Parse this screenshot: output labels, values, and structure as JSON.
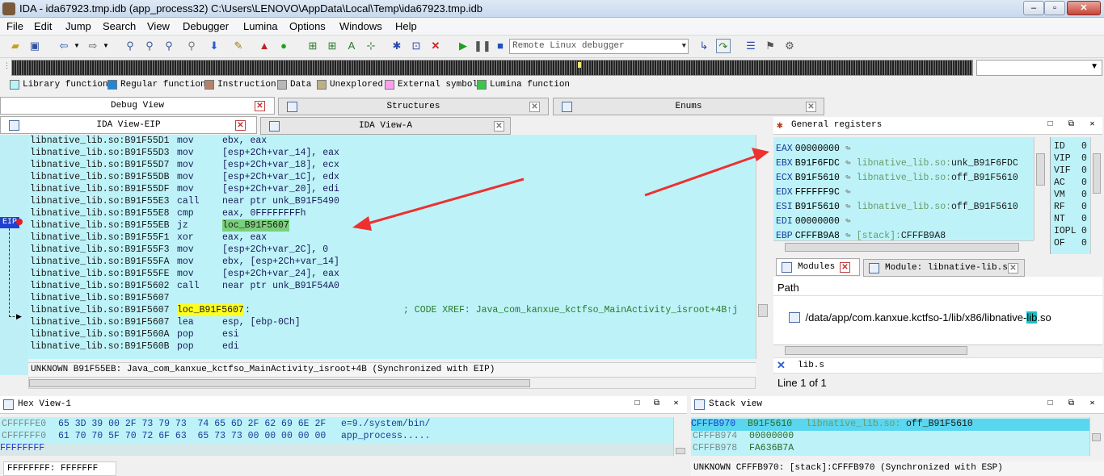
{
  "window": {
    "title": "IDA - ida67923.tmp.idb (app_process32) C:\\Users\\LENOVO\\AppData\\Local\\Temp\\ida67923.tmp.idb"
  },
  "menu": [
    "File",
    "Edit",
    "Jump",
    "Search",
    "View",
    "Debugger",
    "Lumina",
    "Options",
    "Windows",
    "Help"
  ],
  "toolbar": {
    "debugger_select": "Remote Linux debugger"
  },
  "legend": [
    {
      "label": "Library function",
      "color": "#b7f3f9"
    },
    {
      "label": "Regular function",
      "color": "#1e88d8"
    },
    {
      "label": "Instruction",
      "color": "#b5816a"
    },
    {
      "label": "Data",
      "color": "#b8b8b8"
    },
    {
      "label": "Unexplored",
      "color": "#b9b187"
    },
    {
      "label": "External symbol",
      "color": "#ff9ef0"
    },
    {
      "label": "Lumina function",
      "color": "#39c64a"
    }
  ],
  "top_tabs": [
    "Debug View",
    "Structures",
    "Enums"
  ],
  "view_tabs": [
    "IDA View-EIP",
    "IDA View-A"
  ],
  "eip_label": "EIP",
  "code_lines": [
    {
      "addr": "libnative_lib.so:B91F55D1",
      "mn": "mov",
      "op": "ebx, eax"
    },
    {
      "addr": "libnative_lib.so:B91F55D3",
      "mn": "mov",
      "op": "[esp+2Ch+var_14], eax"
    },
    {
      "addr": "libnative_lib.so:B91F55D7",
      "mn": "mov",
      "op": "[esp+2Ch+var_18], ecx"
    },
    {
      "addr": "libnative_lib.so:B91F55DB",
      "mn": "mov",
      "op": "[esp+2Ch+var_1C], edx"
    },
    {
      "addr": "libnative_lib.so:B91F55DF",
      "mn": "mov",
      "op": "[esp+2Ch+var_20], edi"
    },
    {
      "addr": "libnative_lib.so:B91F55E3",
      "mn": "call",
      "op": "near ptr unk_B91F5490"
    },
    {
      "addr": "libnative_lib.so:B91F55E8",
      "mn": "cmp",
      "op": "eax, 0FFFFFFFFh"
    },
    {
      "addr": "libnative_lib.so:B91F55EB",
      "mn": "jz",
      "op": "loc_B91F5607"
    },
    {
      "addr": "libnative_lib.so:B91F55F1",
      "mn": "xor",
      "op": "eax, eax"
    },
    {
      "addr": "libnative_lib.so:B91F55F3",
      "mn": "mov",
      "op": "[esp+2Ch+var_2C], 0"
    },
    {
      "addr": "libnative_lib.so:B91F55FA",
      "mn": "mov",
      "op": "ebx, [esp+2Ch+var_14]"
    },
    {
      "addr": "libnative_lib.so:B91F55FE",
      "mn": "mov",
      "op": "[esp+2Ch+var_24], eax"
    },
    {
      "addr": "libnative_lib.so:B91F5602",
      "mn": "call",
      "op": "near ptr unk_B91F54A0"
    },
    {
      "addr": "libnative_lib.so:B91F5607",
      "mn": "",
      "op": ""
    },
    {
      "addr": "libnative_lib.so:B91F5607",
      "label": "loc_B91F5607",
      "comment": "; CODE XREF: Java_com_kanxue_kctfso_MainActivity_isroot+4B↑j"
    },
    {
      "addr": "libnative_lib.so:B91F5607",
      "mn": "lea",
      "op": "esp, [ebp-0Ch]"
    },
    {
      "addr": "libnative_lib.so:B91F560A",
      "mn": "pop",
      "op": "esi"
    },
    {
      "addr": "libnative_lib.so:B91F560B",
      "mn": "pop",
      "op": "edi"
    }
  ],
  "ida_status": "UNKNOWN B91F55EB: Java_com_kanxue_kctfso_MainActivity_isroot+4B (Synchronized with EIP)",
  "registers_title": "General registers",
  "registers": [
    {
      "name": "EAX",
      "value": "00000000",
      "ref": "",
      "sym": ""
    },
    {
      "name": "EBX",
      "value": "B91F6FDC",
      "ref": "libnative_lib.so:",
      "sym": "unk_B91F6FDC"
    },
    {
      "name": "ECX",
      "value": "B91F5610",
      "ref": "libnative_lib.so:",
      "sym": "off_B91F5610"
    },
    {
      "name": "EDX",
      "value": "FFFFFF9C",
      "ref": "",
      "sym": ""
    },
    {
      "name": "ESI",
      "value": "B91F5610",
      "ref": "libnative_lib.so:",
      "sym": "off_B91F5610"
    },
    {
      "name": "EDI",
      "value": "00000000",
      "ref": "",
      "sym": ""
    },
    {
      "name": "EBP",
      "value": "CFFFB9A8",
      "ref": "[stack]:",
      "sym": "CFFFB9A8"
    }
  ],
  "flags": [
    {
      "name": "ID",
      "v": "0"
    },
    {
      "name": "VIP",
      "v": "0"
    },
    {
      "name": "VIF",
      "v": "0"
    },
    {
      "name": "AC",
      "v": "0"
    },
    {
      "name": "VM",
      "v": "0"
    },
    {
      "name": "RF",
      "v": "0"
    },
    {
      "name": "NT",
      "v": "0"
    },
    {
      "name": "IOPL",
      "v": "0"
    },
    {
      "name": "OF",
      "v": "0"
    }
  ],
  "module_tabs": [
    "Modules",
    "Module: libnative-lib.so"
  ],
  "modules": {
    "header": "Path",
    "row_prefix": "/data/app/com.kanxue.kctfso-1/lib/x86/libnative-",
    "row_highlight": "lib",
    "row_suffix": ".so",
    "filter": "lib.s",
    "count": "Line 1 of 1"
  },
  "hex": {
    "title": "Hex View-1",
    "rows": [
      {
        "addr": "CFFFFFE0",
        "bytes": "65 3D 39 00 2F 73 79 73  74 65 6D 2F 62 69 6E 2F",
        "ascii": "e=9./system/bin/"
      },
      {
        "addr": "CFFFFFF0",
        "bytes": "61 70 70 5F 70 72 6F 63  65 73 73 00 00 00 00 00",
        "ascii": "app_process....."
      },
      {
        "addr": "FFFFFFFF",
        "bytes": "",
        "ascii": ""
      }
    ],
    "status": "FFFFFFFF: FFFFFFF"
  },
  "stack": {
    "title": "Stack view",
    "rows": [
      {
        "addr": "CFFFB970",
        "val": "B91F5610",
        "ref": "libnative_lib.so:",
        "sym": "off_B91F5610"
      },
      {
        "addr": "CFFFB974",
        "val": "00000000",
        "ref": "",
        "sym": ""
      },
      {
        "addr": "CFFFB978",
        "val": "FA636B7A",
        "ref": "",
        "sym": ""
      }
    ],
    "status": "UNKNOWN CFFFB970: [stack]:CFFFB970 (Synchronized with ESP)"
  }
}
